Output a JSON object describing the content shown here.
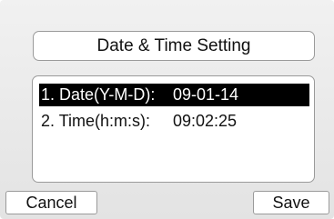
{
  "header": {
    "title": "Date & Time Setting"
  },
  "menu": {
    "items": [
      {
        "label": "1. Date(Y-M-D):",
        "value": "09-01-14",
        "selected": true
      },
      {
        "label": "2. Time(h:m:s):",
        "value": "09:02:25",
        "selected": false
      }
    ]
  },
  "softkeys": {
    "left": "Cancel",
    "right": "Save"
  },
  "colors": {
    "selection_background": "#000000",
    "selection_text": "#ffffff",
    "panel_background": "#ffffff",
    "frame_background": "#e8e8e8",
    "border": "#9a9a9a"
  }
}
